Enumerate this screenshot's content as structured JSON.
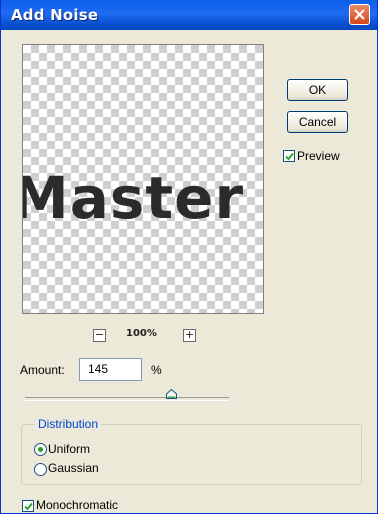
{
  "window": {
    "title": "Add Noise",
    "close_icon": "close-icon"
  },
  "buttons": {
    "ok_label": "OK",
    "cancel_label": "Cancel"
  },
  "preview": {
    "label": "Preview",
    "checked": true,
    "preview_text": "Master",
    "zoom_level": "100%",
    "zoom_out_symbol": "−",
    "zoom_in_symbol": "+"
  },
  "amount": {
    "label": "Amount:",
    "value": "145",
    "unit": "%",
    "slider_fraction": 0.72
  },
  "distribution": {
    "title": "Distribution",
    "options": [
      {
        "label": "Uniform",
        "selected": true
      },
      {
        "label": "Gaussian",
        "selected": false
      }
    ]
  },
  "monochromatic": {
    "label": "Monochromatic",
    "checked": true
  },
  "colors": {
    "title_bar": "#0a5ee8",
    "dialog_bg": "#ece9d8",
    "group_title": "#0046d5",
    "radio_dot": "#21a121"
  }
}
